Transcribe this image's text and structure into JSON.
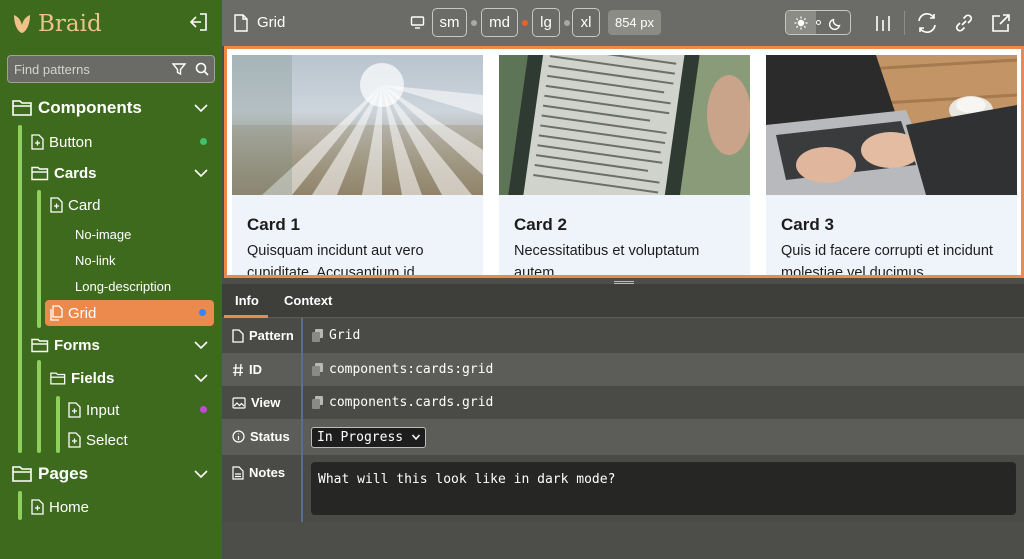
{
  "app": {
    "brand": "Braid"
  },
  "search": {
    "placeholder": "Find patterns"
  },
  "nav": {
    "components": "Components",
    "button": "Button",
    "cards": "Cards",
    "card": "Card",
    "no_image": "No-image",
    "no_link": "No-link",
    "long_description": "Long-description",
    "grid": "Grid",
    "forms": "Forms",
    "fields": "Fields",
    "input": "Input",
    "select": "Select",
    "pages": "Pages",
    "home": "Home"
  },
  "status_colors": {
    "button": "#3ec46d",
    "grid": "#3b82f6",
    "input": "#c04ad8"
  },
  "toolbar": {
    "title": "Grid",
    "breakpoints": [
      "sm",
      "md",
      "lg",
      "xl"
    ],
    "active_dot_color": "#e8632b",
    "width_label": "854 px"
  },
  "preview": {
    "cards": [
      {
        "title": "Card 1",
        "text": "Quisquam incidunt aut vero cupiditate. Accusantium id"
      },
      {
        "title": "Card 2",
        "text": "Necessitatibus et voluptatum autem."
      },
      {
        "title": "Card 3",
        "text": "Quis id facere corrupti et incidunt molestiae vel ducimus"
      }
    ]
  },
  "panel": {
    "tabs": [
      "Info",
      "Context"
    ],
    "rows": {
      "pattern_label": "Pattern",
      "pattern_value": "Grid",
      "id_label": "ID",
      "id_value": "components:cards:grid",
      "view_label": "View",
      "view_value": "components.cards.grid",
      "status_label": "Status",
      "status_value": "In Progress",
      "notes_label": "Notes",
      "notes_value": "What will this look like in dark mode?"
    }
  },
  "colors": {
    "sidebar": "#3e6a1e",
    "accent": "#ec8a4e",
    "tree_line": "#8dd05c"
  }
}
